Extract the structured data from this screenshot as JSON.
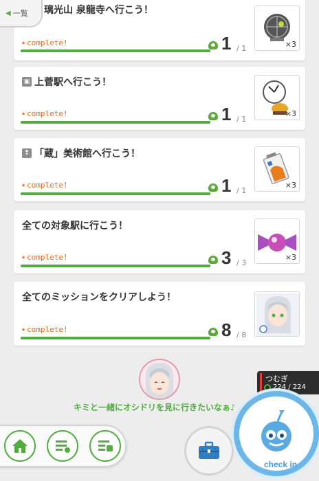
{
  "back": {
    "label": "一覧"
  },
  "missions": [
    {
      "title": "璃光山 泉龍寺へ行こう！",
      "status": "complete!",
      "count": "1",
      "total": "/ 1",
      "reward_qty": "×3",
      "reward": "armillary-sphere-icon",
      "title_icon": ""
    },
    {
      "title": "上菅駅へ行こう！",
      "status": "complete!",
      "count": "1",
      "total": "/ 1",
      "reward_qty": "×3",
      "reward": "clock-bird-icon",
      "title_icon": "train-icon"
    },
    {
      "title": "「蔵」美術館へ行こう！",
      "status": "complete!",
      "count": "1",
      "total": "/ 1",
      "reward_qty": "×3",
      "reward": "battery-icon",
      "title_icon": "footprint-icon"
    },
    {
      "title": "全ての対象駅に行こう！",
      "status": "complete!",
      "count": "3",
      "total": "/ 3",
      "reward_qty": "×3",
      "reward": "candy-icon",
      "title_icon": ""
    },
    {
      "title": "全てのミッションをクリアしよう！",
      "status": "complete!",
      "count": "8",
      "total": "/ 8",
      "reward_qty": "",
      "reward": "character-portrait-icon",
      "title_icon": ""
    }
  ],
  "character": {
    "name": "つむぎ",
    "gauge": "224 / 224",
    "message": "キミと一緒にオシドリを見に行きたいなぁ♪"
  },
  "checkin": {
    "label": "check in"
  },
  "colors": {
    "accent_green": "#4fae3e",
    "complete_orange": "#ea6a1a",
    "checkin_blue": "#6cb6ea"
  }
}
